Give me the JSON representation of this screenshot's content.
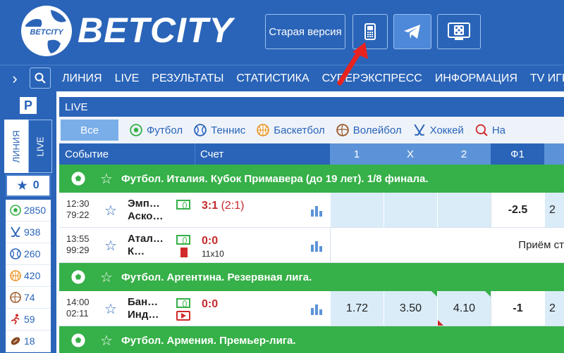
{
  "brand": {
    "name": "BETCITY",
    "globe_text": "BETCITY"
  },
  "header": {
    "old_version_label": "Старая версия",
    "mobile_icon": "mobile-phone-icon",
    "telegram_icon": "telegram-icon",
    "tv_icon": "tv-games-icon"
  },
  "nav": {
    "items": [
      "ЛИНИЯ",
      "LIVE",
      "РЕЗУЛЬТАТЫ",
      "СТАТИСТИКА",
      "СУПЕРЭКСПРЕСС",
      "ИНФОРМАЦИЯ",
      "TV ИГРЫ"
    ]
  },
  "sidebar": {
    "p_label": "P",
    "tab_line": "ЛИНИЯ",
    "tab_live": "LIVE",
    "favorites_count": "0",
    "sports": [
      {
        "icon": "football-icon",
        "count": "2850"
      },
      {
        "icon": "hockey-icon",
        "count": "938"
      },
      {
        "icon": "tennis-icon",
        "count": "260"
      },
      {
        "icon": "basketball-icon",
        "count": "420"
      },
      {
        "icon": "volleyball-icon",
        "count": "74"
      },
      {
        "icon": "athletics-icon",
        "count": "59"
      },
      {
        "icon": "american-football-icon",
        "count": "18"
      }
    ]
  },
  "main": {
    "live_title": "LIVE",
    "filter_all": "Все",
    "sports": [
      "Футбол",
      "Теннис",
      "Баскетбол",
      "Волейбол",
      "Хоккей",
      "На"
    ],
    "columns": {
      "event": "Событие",
      "score": "Счет",
      "c1": "1",
      "cx": "X",
      "c2": "2",
      "f1": "Ф1"
    },
    "leagues": [
      {
        "name": "Футбол. Италия. Кубок Примавера (до 19 лет). 1/8 финала."
      },
      {
        "name": "Футбол. Аргентина. Резервная лига."
      },
      {
        "name": "Футбол. Армения. Премьер-лига."
      }
    ],
    "matches": [
      {
        "time": "12:30",
        "clock": "79:22",
        "team1": "Эмп…",
        "team2": "Аско…",
        "score": "3:1",
        "half": "(2:1)",
        "sub": "",
        "odds1": "",
        "oddsx": "",
        "odds2": "",
        "f1": "-2.5",
        "more": "2"
      },
      {
        "time": "13:55",
        "clock": "99:29",
        "team1": "Атал…",
        "team2": "К…",
        "score": "0:0",
        "half": "",
        "sub": "11x10",
        "closed_text": "Приём ст"
      },
      {
        "time": "14:00",
        "clock": "02:11",
        "team1": "Бан…",
        "team2": "Инд…",
        "score": "0:0",
        "half": "",
        "sub": "",
        "odds1": "1.72",
        "oddsx": "3.50",
        "odds2": "4.10",
        "f1": "-1",
        "more": "2"
      }
    ]
  },
  "colors": {
    "brand_blue": "#2a64b8",
    "league_green": "#36b048",
    "score_red": "#c42a2a",
    "odds_bg": "#d9ecf8"
  }
}
